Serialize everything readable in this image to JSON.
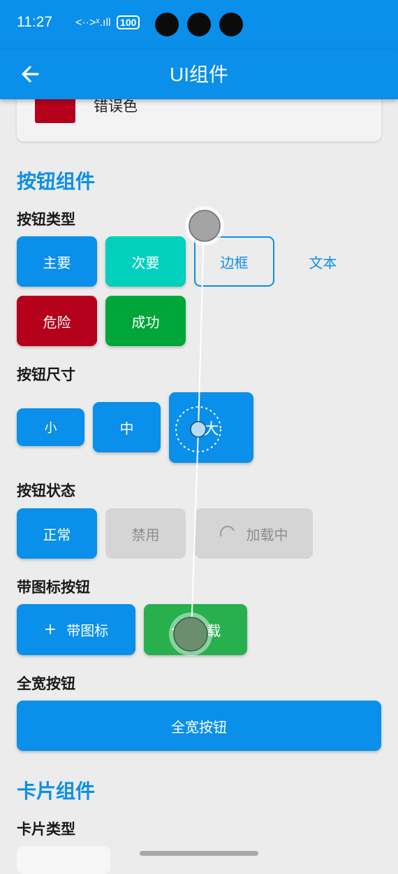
{
  "status_bar": {
    "time": "11:27",
    "signal_text": "<··>ˣ.ıll",
    "battery": "100"
  },
  "app_bar": {
    "title": "UI组件"
  },
  "color_card": {
    "label": "错误色"
  },
  "buttons_section": {
    "title": "按钮组件",
    "types": {
      "title": "按钮类型",
      "primary": "主要",
      "secondary": "次要",
      "outline": "边框",
      "text": "文本",
      "danger": "危险",
      "success": "成功"
    },
    "sizes": {
      "title": "按钮尺寸",
      "small": "小",
      "medium": "中",
      "large": "大"
    },
    "states": {
      "title": "按钮状态",
      "normal": "正常",
      "disabled": "禁用",
      "loading": "加载中"
    },
    "icons": {
      "title": "带图标按钮",
      "with_icon": "带图标",
      "download": "下载",
      "plus": "+"
    },
    "full_width": {
      "title": "全宽按钮",
      "button": "全宽按钮"
    }
  },
  "cards_section": {
    "title": "卡片组件",
    "types_title": "卡片类型"
  },
  "colors": {
    "primary": "#0a8fea",
    "secondary": "#00d0bc",
    "danger": "#b5001b",
    "success": "#00a63a"
  }
}
